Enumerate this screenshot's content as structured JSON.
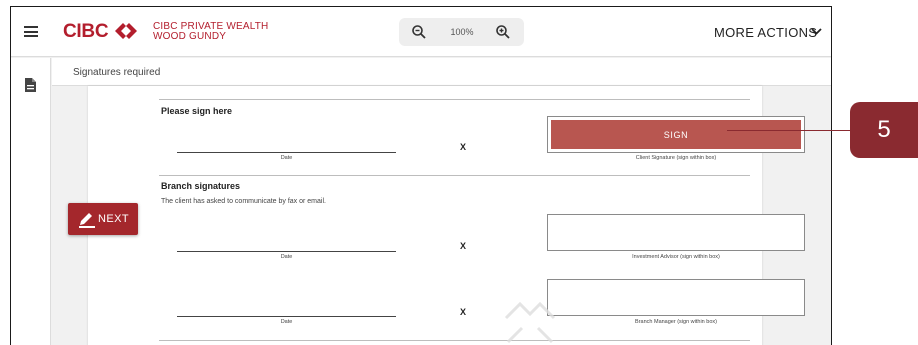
{
  "header": {
    "logo_text": "CIBC",
    "brand_line1": "CIBC PRIVATE WEALTH",
    "brand_line2": "WOOD GUNDY",
    "zoom_level": "100%",
    "more_actions_label": "MORE ACTIONS"
  },
  "subbar": {
    "label": "Signatures required"
  },
  "document": {
    "please_sign_heading": "Please sign here",
    "date_label": "Date",
    "x_mark": "X",
    "sign_button_label": "SIGN",
    "client_signature_caption": "Client Signature (sign within box)",
    "branch_heading": "Branch signatures",
    "branch_note": "The client has asked to communicate by fax or email.",
    "investment_advisor_caption": "Investment Advisor (sign within box)",
    "branch_manager_caption": "Branch Manager (sign within box)"
  },
  "next_button": {
    "label": "NEXT"
  },
  "callout": {
    "number": "5"
  },
  "colors": {
    "brand_red": "#b31e2d",
    "next_red": "#a4272c",
    "sign_button": "#b85650",
    "callout": "#8a2a30"
  }
}
